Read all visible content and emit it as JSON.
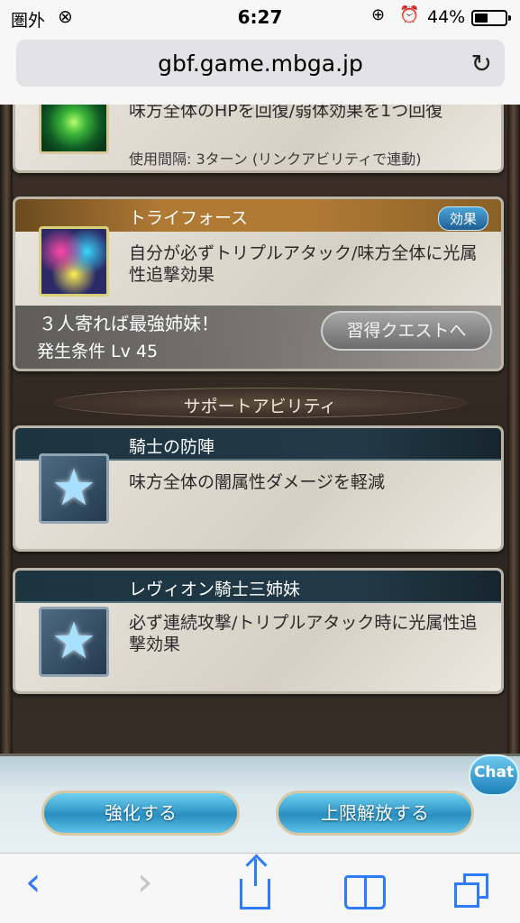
{
  "status_bar": {
    "carrier": "圏外",
    "time": "6:27",
    "battery_text": "44%",
    "battery_level": 0.44
  },
  "browser": {
    "url": "gbf.game.mbga.jp"
  },
  "abilities": [
    {
      "desc": "味方全体のHPを回復/弱体効果を1つ回復",
      "cooldown": "使用間隔: 3ターン (リンクアビリティで連動)"
    },
    {
      "title": "トライフォース",
      "badge": "効果",
      "desc": "自分が必ずトリプルアタック/味方全体に光属性追撃効果",
      "flavor": "３人寄れば最強姉妹！",
      "condition": "発生条件 Lv 45",
      "quest_button": "習得クエストへ"
    }
  ],
  "support_section_label": "サポートアビリティ",
  "support_abilities": [
    {
      "title": "騎士の防陣",
      "desc": "味方全体の闇属性ダメージを軽減"
    },
    {
      "title": "レヴィオン騎士三姉妹",
      "desc": "必ず連続攻撃/トリプルアタック時に光属性追撃効果"
    }
  ],
  "game_buttons": {
    "enhance": "強化する",
    "limit_break": "上限解放する",
    "chat": "Chat"
  }
}
